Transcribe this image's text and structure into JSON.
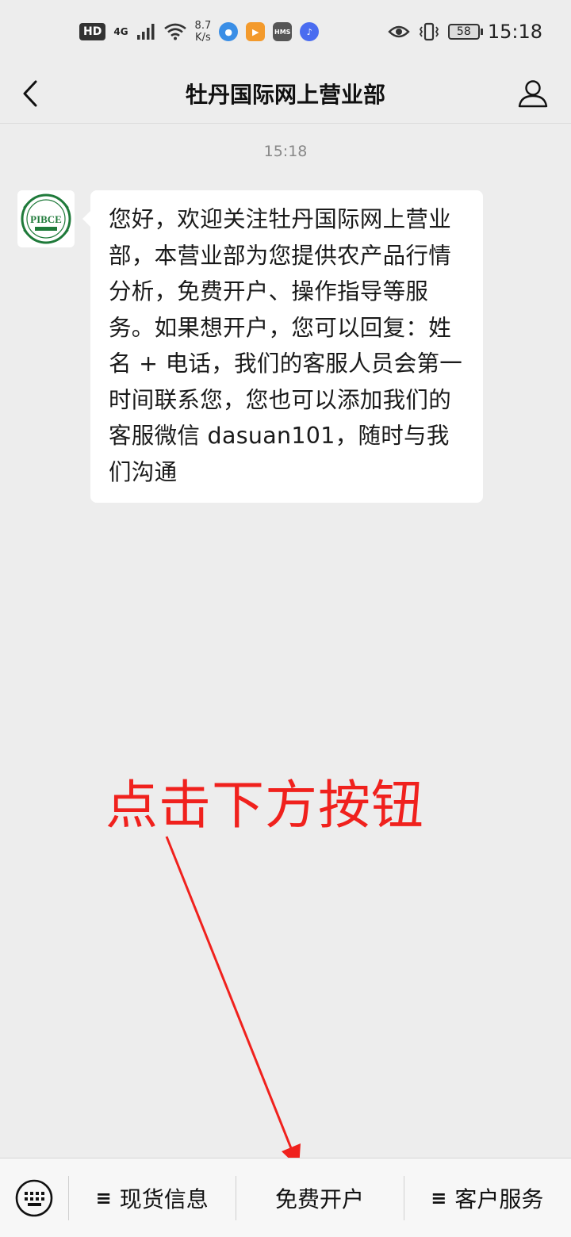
{
  "status_bar": {
    "hd": "HD",
    "network": "4G",
    "speed_value": "8.7",
    "speed_unit": "K/s",
    "battery": "58",
    "time": "15:18",
    "app_icons": [
      "browser-icon",
      "video-app-icon",
      "hms-icon",
      "music-icon"
    ]
  },
  "header": {
    "title": "牡丹国际网上营业部"
  },
  "chat": {
    "timestamp": "15:18",
    "message": "您好，欢迎关注牡丹国际网上营业部，本营业部为您提供农产品行情分析，免费开户、操作指导等服务。如果想开户，您可以回复：姓名 + 电话，我们的客服人员会第一时间联系您，您也可以添加我们的客服微信 dasuan101，随时与我们沟通",
    "avatar_text": "PIBCE"
  },
  "annotation": {
    "text": "点击下方按钮",
    "color": "#f0211d"
  },
  "bottom_menu": {
    "items": [
      {
        "label": "现货信息",
        "has_submenu": true
      },
      {
        "label": "免费开户",
        "has_submenu": false
      },
      {
        "label": "客户服务",
        "has_submenu": true
      }
    ],
    "submenu_icon": "≡"
  }
}
